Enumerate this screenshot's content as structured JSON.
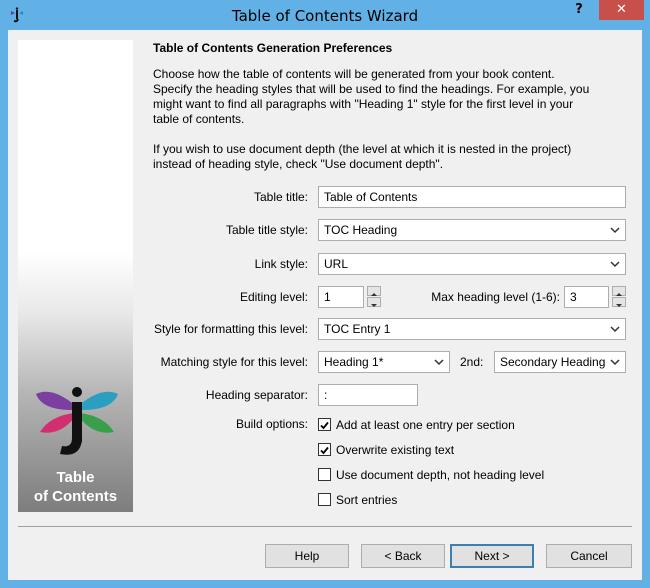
{
  "window": {
    "title": "Table of Contents Wizard",
    "help_label": "?",
    "close_label": "✕"
  },
  "side_panel": {
    "caption_line1": "Table",
    "caption_line2": "of Contents"
  },
  "content": {
    "heading": "Table of Contents Generation Preferences",
    "paragraph1": "Choose how the table of contents will be generated from your book content. Specify the heading styles that will be used to find the headings. For example, you might want to find all paragraphs with \"Heading 1\" style for the first level in your table of contents.",
    "paragraph2": "If you wish to use document depth (the level at which it is nested in the project) instead of heading style, check \"Use document depth\"."
  },
  "form": {
    "table_title_label": "Table title:",
    "table_title_value": "Table of Contents",
    "table_title_style_label": "Table title style:",
    "table_title_style_value": "TOC Heading",
    "link_style_label": "Link style:",
    "link_style_value": "URL",
    "editing_level_label": "Editing level:",
    "editing_level_value": "1",
    "max_heading_label": "Max heading level (1-6):",
    "max_heading_value": "3",
    "style_formatting_label": "Style for formatting this level:",
    "style_formatting_value": "TOC Entry 1",
    "matching_style_label": "Matching style for this level:",
    "matching_style_value": "Heading 1*",
    "second_label": "2nd:",
    "second_value": "Secondary Heading",
    "heading_separator_label": "Heading separator:",
    "heading_separator_value": ":",
    "build_options_label": "Build options:",
    "options": [
      {
        "label": "Add at least one entry per section",
        "checked": true
      },
      {
        "label": "Overwrite existing text",
        "checked": true
      },
      {
        "label": "Use document depth, not heading level",
        "checked": false
      },
      {
        "label": "Sort entries",
        "checked": false
      }
    ]
  },
  "buttons": {
    "help": "Help",
    "back": "< Back",
    "next": "Next >",
    "cancel": "Cancel"
  },
  "colors": {
    "title_bar": "#62b1e6",
    "close_button": "#c7504a",
    "dialog_bg": "#f0f0f0"
  }
}
